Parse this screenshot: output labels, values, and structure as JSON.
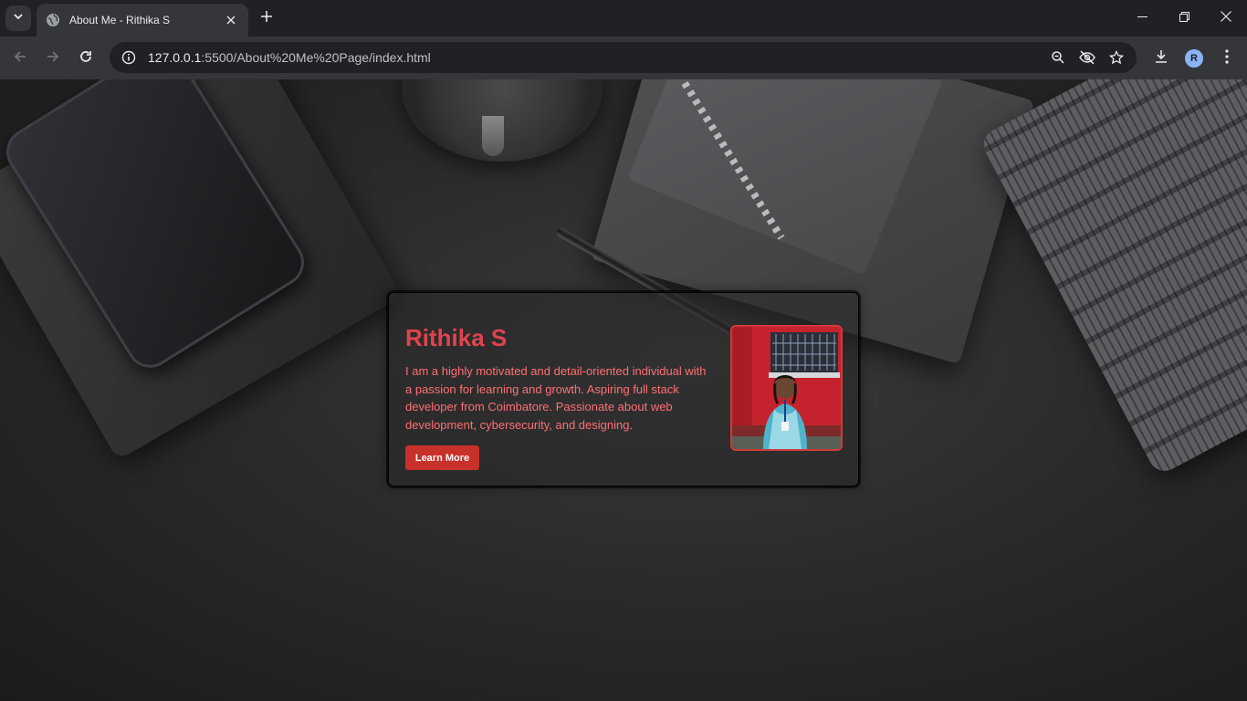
{
  "browser": {
    "tab_title": "About Me - Rithika S",
    "url_host": "127.0.0.1",
    "url_rest": ":5500/About%20Me%20Page/index.html",
    "profile_initial": "R"
  },
  "card": {
    "name": "Rithika S",
    "bio": "I am a highly motivated and detail-oriented individual with a passion for learning and growth. Aspiring full stack developer from Coimbatore. Passionate about web development, cybersecurity, and designing.",
    "button_label": "Learn More"
  },
  "colors": {
    "name": "#e0434f",
    "bio": "#ff6f73",
    "button": "#c8302a",
    "photo_border": "#d23a3a"
  }
}
